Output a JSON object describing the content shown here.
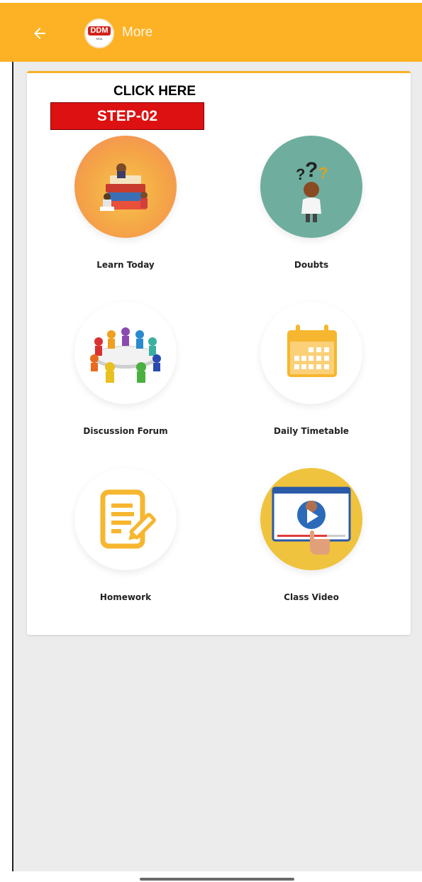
{
  "appbar": {
    "title": "More",
    "logo_text": "DDM",
    "logo_sub": "MSA"
  },
  "callout": {
    "text": "CLICK HERE",
    "step": "STEP-02"
  },
  "tiles": [
    {
      "label": "Learn Today",
      "icon": "books-reading-icon"
    },
    {
      "label": "Doubts",
      "icon": "question-thinking-icon"
    },
    {
      "label": "Discussion Forum",
      "icon": "group-meeting-icon"
    },
    {
      "label": "Daily Timetable",
      "icon": "calendar-icon"
    },
    {
      "label": "Homework",
      "icon": "document-pencil-icon"
    },
    {
      "label": "Class Video",
      "icon": "video-player-icon"
    }
  ],
  "colors": {
    "appbar": "#fcb224",
    "card_accent": "#f6b126",
    "step_banner": "#dd1111"
  }
}
